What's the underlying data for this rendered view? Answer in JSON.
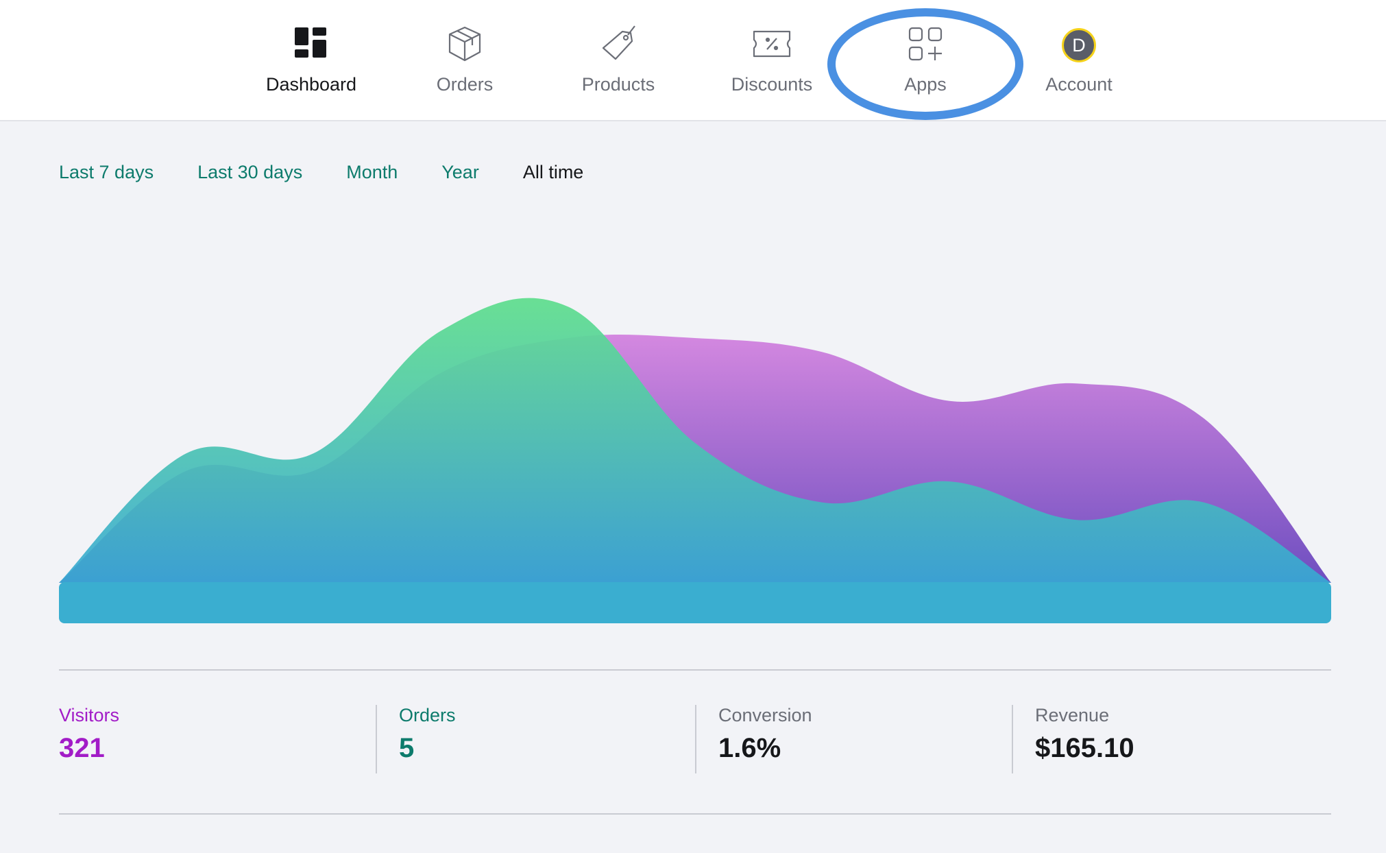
{
  "nav": {
    "items": [
      {
        "label": "Dashboard",
        "icon": "dashboard-icon",
        "active": true
      },
      {
        "label": "Orders",
        "icon": "box-icon",
        "active": false
      },
      {
        "label": "Products",
        "icon": "tag-icon",
        "active": false
      },
      {
        "label": "Discounts",
        "icon": "discount-ticket-icon",
        "active": false
      },
      {
        "label": "Apps",
        "icon": "apps-grid-icon",
        "active": false
      },
      {
        "label": "Account",
        "icon": "avatar",
        "active": false
      }
    ],
    "avatar_initial": "D",
    "highlight_color": "#4a90e2"
  },
  "filters": {
    "tabs": [
      "Last 7 days",
      "Last 30 days",
      "Month",
      "Year",
      "All time"
    ],
    "selected": "All time"
  },
  "chart_data": {
    "type": "area",
    "x": [
      0,
      1,
      2,
      3,
      4,
      5,
      6,
      7,
      8,
      9,
      10
    ],
    "series": [
      {
        "name": "Visitors",
        "color": "#b06bd8",
        "values": [
          0,
          32,
          32,
          60,
          70,
          70,
          66,
          52,
          57,
          47,
          0
        ]
      },
      {
        "name": "Orders",
        "color": "#5edc96",
        "values": [
          0,
          37,
          37,
          72,
          79,
          40,
          23,
          29,
          18,
          23,
          0
        ]
      }
    ],
    "ylim": [
      0,
      100
    ]
  },
  "stats": [
    {
      "label": "Visitors",
      "value": "321",
      "color": "#a21cc7"
    },
    {
      "label": "Orders",
      "value": "5",
      "color": "#0d7b6c"
    },
    {
      "label": "Conversion",
      "value": "1.6%",
      "color": "#16171a"
    },
    {
      "label": "Revenue",
      "value": "$165.10",
      "color": "#16171a"
    }
  ]
}
